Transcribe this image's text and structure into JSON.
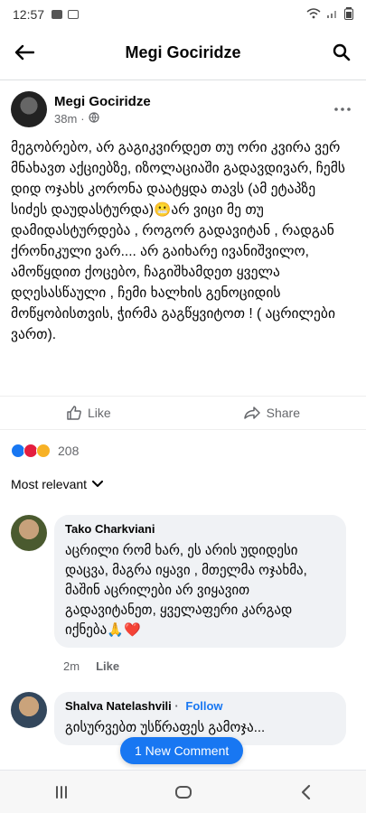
{
  "status_bar": {
    "time": "12:57",
    "battery": ""
  },
  "top_nav": {
    "title": "Megi Gociridze"
  },
  "post": {
    "author": "Megi Gociridze",
    "time": "38m",
    "time_separator": "·",
    "text": "მეგობრებო, არ გაგიკვირდეთ თუ ორი კვირა ვერ მნახავთ აქციებზე, იზოლაციაში გადავდივარ, ჩემს დიდ ოჯახს კორონა დაატყდა თავს (ამ ეტაპზე სიძეს დაუდასტურდა)😬არ ვიცი მე თუ დამიდასტურდება , როგორ გადავიტან , რადგან ქრონიკული ვარ.... არ გაიხარე ივანიშვილო, ამოწყდით ქოცებო, ჩაგიშხამდეთ ყველა დღესასწაული , ჩემი ხალხის გენოციდის მოწყობისთვის, ჭირმა გაგწყვიტოთ ! ( აცრილები ვართ).",
    "like_label": "Like",
    "share_label": "Share",
    "reaction_count": "208"
  },
  "comments_sort": {
    "label": "Most relevant"
  },
  "comments": [
    {
      "author": "Tako Charkviani",
      "text": "აცრილი რომ ხარ, ეს არის უდიდესი დაცვა, მაგრა იყავი , მთელმა ოჯახმა, მაშინ აცრილები არ ვიყავით გადავიტანეთ, ყველაფერი კარგად იქნება🙏❤️",
      "time": "2m",
      "like_label": "Like"
    },
    {
      "author": "Shalva Natelashvili",
      "follow_separator": "·",
      "follow_label": "Follow",
      "text": "გისურვებთ უსწრაფეს გამოჯა..."
    }
  ],
  "new_comment_label": "1 New Comment",
  "colors": {
    "accent": "#1877f2",
    "bubble_bg": "#f0f2f5",
    "muted": "#65676b"
  }
}
